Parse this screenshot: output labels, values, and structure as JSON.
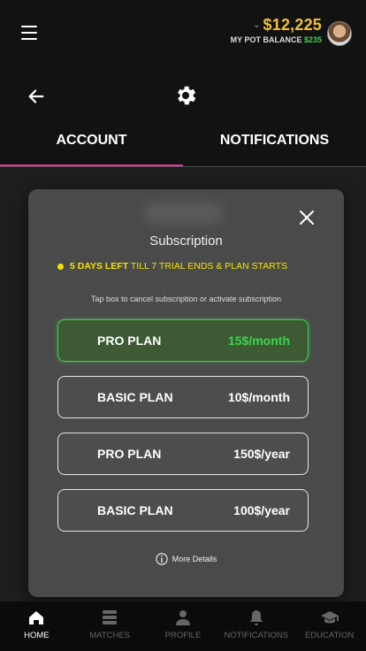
{
  "header": {
    "balance": "$12,225",
    "pot_label": "MY POT BALANCE",
    "pot_value": "$235"
  },
  "tabs": [
    {
      "label": "ACCOUNT",
      "active": true
    },
    {
      "label": "NOTIFICATIONS",
      "active": false
    }
  ],
  "modal": {
    "title": "Subscription",
    "trial_strong": "5 DAYS LEFT",
    "trial_rest": "TILL 7 TRIAL ENDS & PLAN STARTS",
    "hint": "Tap box to cancel subscription or activate subscription",
    "plans": [
      {
        "name": "PRO PLAN",
        "price": "15$/month",
        "active": true
      },
      {
        "name": "BASIC PLAN",
        "price": "10$/month",
        "active": false
      },
      {
        "name": "PRO PLAN",
        "price": "150$/year",
        "active": false
      },
      {
        "name": "BASIC PLAN",
        "price": "100$/year",
        "active": false
      }
    ],
    "more_details": "More Details"
  },
  "nav": [
    {
      "label": "HOME",
      "icon": "home-icon",
      "active": true
    },
    {
      "label": "MATCHES",
      "icon": "matches-icon",
      "active": false
    },
    {
      "label": "PROFILE",
      "icon": "profile-icon",
      "active": false
    },
    {
      "label": "NOTIFICATIONS",
      "icon": "bell-icon",
      "active": false
    },
    {
      "label": "EDUCATION",
      "icon": "graduation-cap-icon",
      "active": false
    }
  ],
  "colors": {
    "accent_pink": "#e8349b",
    "balance_gold": "#f2c230",
    "active_green": "#39d64a",
    "trial_yellow": "#f2e400"
  }
}
